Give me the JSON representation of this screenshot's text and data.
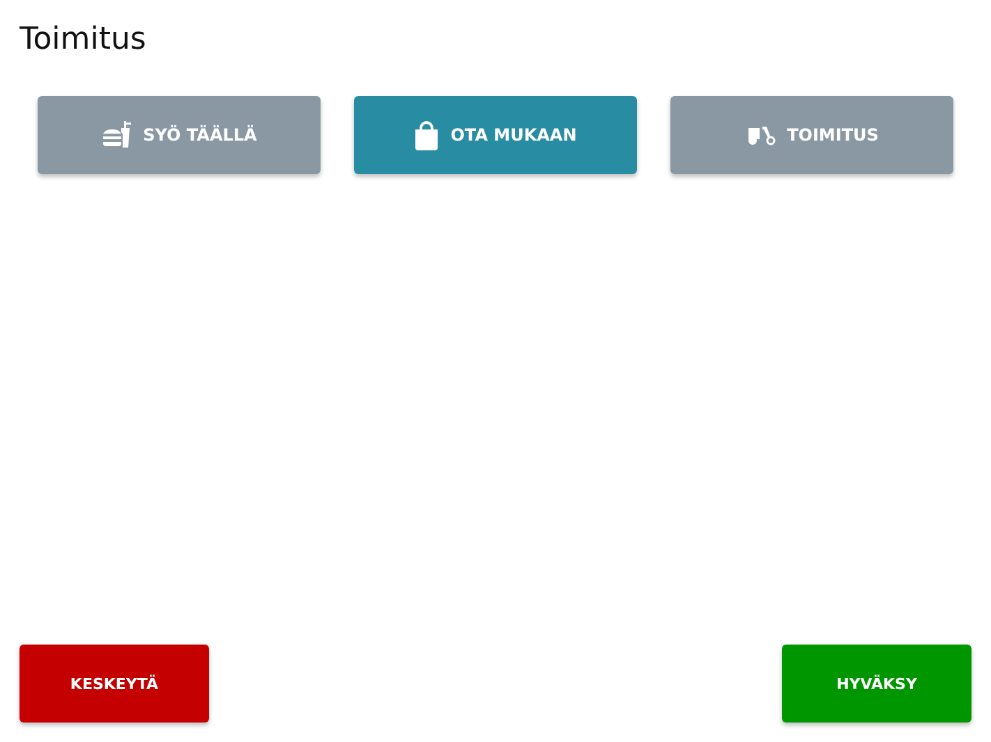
{
  "title": "Toimitus",
  "options": [
    {
      "kind": "dine-in",
      "label": "SYÖ TÄÄLLÄ",
      "selected": false
    },
    {
      "kind": "takeaway",
      "label": "OTA MUKAAN",
      "selected": true
    },
    {
      "kind": "delivery",
      "label": "TOIMITUS",
      "selected": false
    }
  ],
  "actions": [
    {
      "kind": "cancel",
      "label": "KESKEYTÄ"
    },
    {
      "kind": "accept",
      "label": "HYVÄKSY"
    }
  ]
}
